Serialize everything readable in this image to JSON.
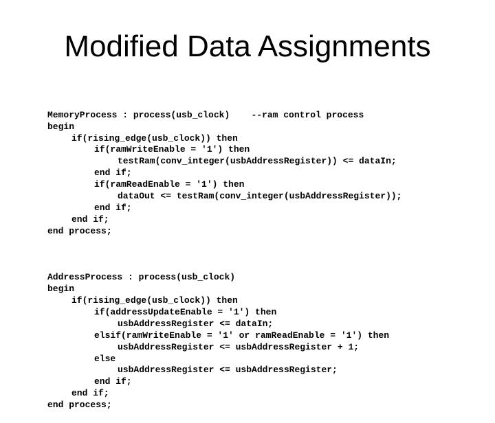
{
  "slide": {
    "title": "Modified Data Assignments",
    "code_blocks": [
      {
        "name": "memory-process",
        "lines": [
          {
            "indent": 0,
            "text": "MemoryProcess : process(usb_clock)    --ram control process"
          },
          {
            "indent": 0,
            "text": "begin"
          },
          {
            "indent": 1,
            "text": "if(rising_edge(usb_clock)) then"
          },
          {
            "indent": 2,
            "text": "if(ramWriteEnable = '1') then"
          },
          {
            "indent": 3,
            "text": "testRam(conv_integer(usbAddressRegister)) <= dataIn;"
          },
          {
            "indent": 2,
            "text": "end if;"
          },
          {
            "indent": 2,
            "text": "if(ramReadEnable = '1') then"
          },
          {
            "indent": 3,
            "text": "dataOut <= testRam(conv_integer(usbAddressRegister));"
          },
          {
            "indent": 2,
            "text": "end if;"
          },
          {
            "indent": 1,
            "text": "end if;"
          },
          {
            "indent": 0,
            "text": "end process;"
          }
        ]
      },
      {
        "name": "address-process",
        "lines": [
          {
            "indent": 0,
            "text": "AddressProcess : process(usb_clock)"
          },
          {
            "indent": 0,
            "text": "begin"
          },
          {
            "indent": 1,
            "text": "if(rising_edge(usb_clock)) then"
          },
          {
            "indent": 2,
            "text": "if(addressUpdateEnable = '1') then"
          },
          {
            "indent": 3,
            "text": "usbAddressRegister <= dataIn;"
          },
          {
            "indent": 2,
            "text": "elsif(ramWriteEnable = '1' or ramReadEnable = '1') then"
          },
          {
            "indent": 3,
            "text": "usbAddressRegister <= usbAddressRegister + 1;"
          },
          {
            "indent": 2,
            "text": "else"
          },
          {
            "indent": 3,
            "text": "usbAddressRegister <= usbAddressRegister;"
          },
          {
            "indent": 2,
            "text": "end if;"
          },
          {
            "indent": 1,
            "text": "end if;"
          },
          {
            "indent": 0,
            "text": "end process;"
          }
        ]
      }
    ]
  }
}
